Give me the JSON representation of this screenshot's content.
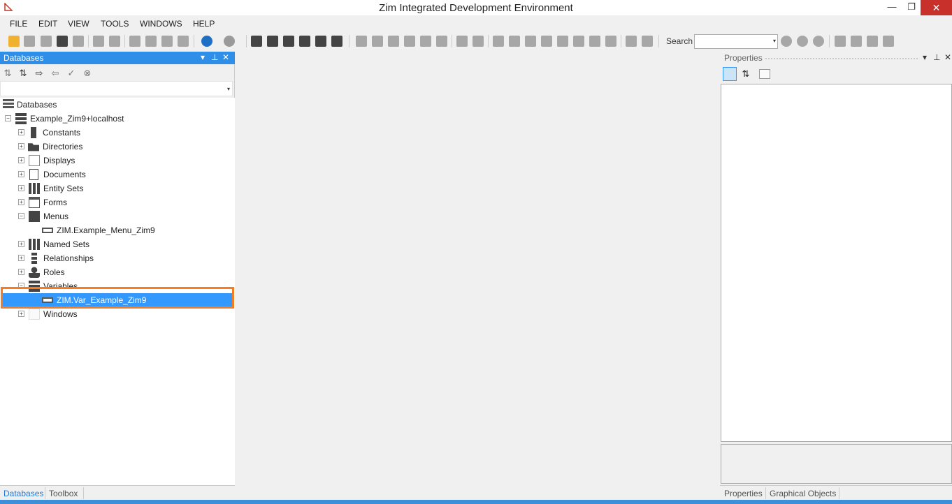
{
  "window": {
    "title": "Zim Integrated Development Environment",
    "minimize": "—",
    "restore": "❐",
    "close": "✕"
  },
  "menu": [
    "FILE",
    "EDIT",
    "VIEW",
    "TOOLS",
    "WINDOWS",
    "HELP"
  ],
  "toolbar": {
    "search_label": "Search",
    "search_value": ""
  },
  "databases_panel": {
    "title": "Databases",
    "pin": "⊥",
    "close": "✕",
    "dropdown": "▾",
    "combo_value": "",
    "tree": {
      "root": "Databases",
      "connection": "Example_Zim9+localhost",
      "items": [
        {
          "label": "Constants",
          "icon": "constants-icon",
          "expanded": false
        },
        {
          "label": "Directories",
          "icon": "directories-icon",
          "expanded": false
        },
        {
          "label": "Displays",
          "icon": "displays-icon",
          "expanded": false
        },
        {
          "label": "Documents",
          "icon": "documents-icon",
          "expanded": false
        },
        {
          "label": "Entity Sets",
          "icon": "entity-sets-icon",
          "expanded": false
        },
        {
          "label": "Forms",
          "icon": "forms-icon",
          "expanded": false
        },
        {
          "label": "Menus",
          "icon": "menus-icon",
          "expanded": true,
          "children": [
            "ZIM.Example_Menu_Zim9"
          ]
        },
        {
          "label": "Named Sets",
          "icon": "named-sets-icon",
          "expanded": false
        },
        {
          "label": "Relationships",
          "icon": "relationships-icon",
          "expanded": false
        },
        {
          "label": "Roles",
          "icon": "roles-icon",
          "expanded": false
        },
        {
          "label": "Variables",
          "icon": "variables-icon",
          "expanded": true,
          "children": [
            "ZIM.Var_Example_Zim9"
          ]
        },
        {
          "label": "Windows",
          "icon": "windows-icon",
          "expanded": false
        }
      ],
      "selected": "ZIM.Var_Example_Zim9"
    },
    "tabs": [
      "Databases",
      "Toolbox"
    ]
  },
  "properties_panel": {
    "title": "Properties",
    "pin": "⊥",
    "close": "✕",
    "dropdown": "▾",
    "tabs": [
      "Properties",
      "Graphical Objects"
    ]
  },
  "colors": {
    "accent": "#2f8fe8",
    "selection": "#3399ff",
    "highlight_border": "#f57c20",
    "close_button": "#c7302b"
  }
}
